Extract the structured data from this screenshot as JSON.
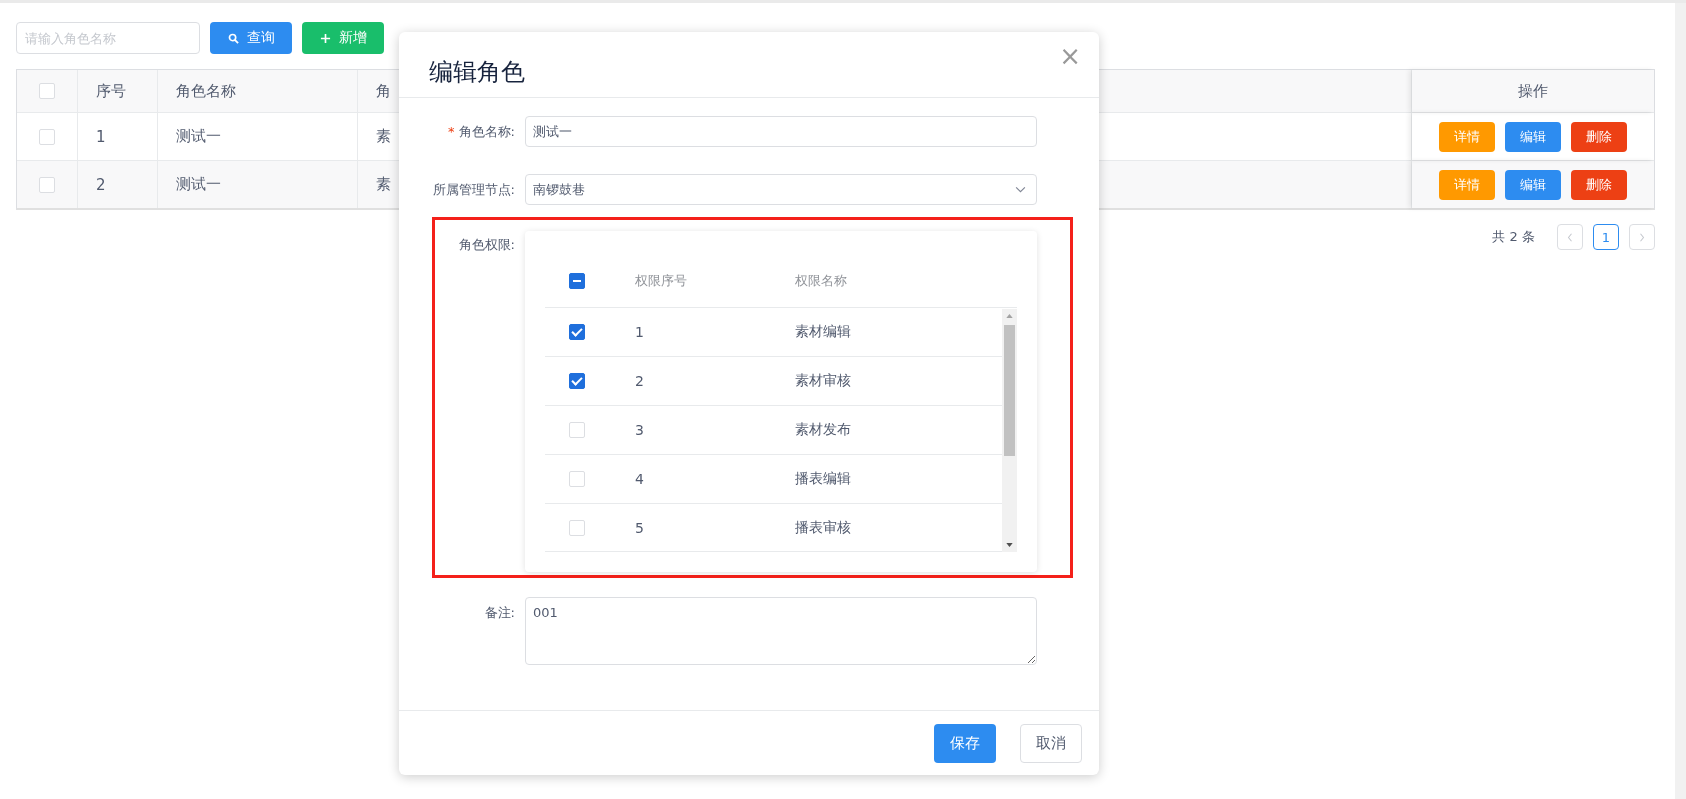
{
  "search": {
    "placeholder": "请输入角色名称"
  },
  "toolbar_buttons": [
    {
      "label": "查询",
      "kind": "search"
    },
    {
      "label": "新增",
      "kind": "add"
    }
  ],
  "table": {
    "header_checked": false,
    "columns": [
      {
        "label": "序号"
      },
      {
        "label": "角色名称"
      },
      {
        "label": "角"
      }
    ],
    "action_column": "操作",
    "rows": [
      {
        "checked": false,
        "index": "1",
        "name": "测试一",
        "column_4": "素",
        "actions": [
          {
            "label": "详情",
            "kind": "detail"
          },
          {
            "label": "编辑",
            "kind": "edit"
          },
          {
            "label": "删除",
            "kind": "delete"
          }
        ]
      },
      {
        "checked": false,
        "index": "2",
        "name": "测试一",
        "column_4": "素",
        "actions": [
          {
            "label": "详情",
            "kind": "detail"
          },
          {
            "label": "编辑",
            "kind": "edit"
          },
          {
            "label": "删除",
            "kind": "delete"
          }
        ]
      }
    ]
  },
  "pagination": {
    "total": "共 2 条",
    "pages": [
      {
        "label": "1",
        "selected": true
      }
    ]
  },
  "dialog": {
    "title": "编辑角色",
    "close": "×",
    "name_field": {
      "label": "角色名称:",
      "required_mark": "*",
      "value": "测试一"
    },
    "node_field": {
      "label": "所属管理节点:",
      "value": "南锣鼓巷"
    },
    "permissions": {
      "label": "角色权限:",
      "select_all_partial": true,
      "columns": [
        "权限序号",
        "权限名称"
      ],
      "rows": [
        {
          "checked": true,
          "index": "1",
          "name": "素材编辑"
        },
        {
          "checked": true,
          "index": "2",
          "name": "素材审核"
        },
        {
          "checked": false,
          "index": "3",
          "name": "素材发布"
        },
        {
          "checked": false,
          "index": "4",
          "name": "播表编辑"
        },
        {
          "checked": false,
          "index": "5",
          "name": "播表审核"
        }
      ]
    },
    "remark_field": {
      "label": "备注:",
      "value": "001"
    },
    "buttons": [
      {
        "label": "保存",
        "kind": "primary"
      },
      {
        "label": "取消",
        "kind": "default"
      }
    ]
  }
}
